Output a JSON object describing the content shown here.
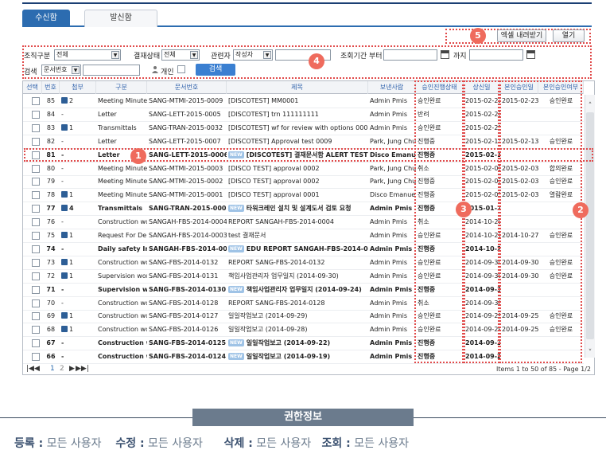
{
  "tabs": {
    "received": "수신함",
    "sent": "발신함"
  },
  "actions": {
    "excel": "엑셀 내려받기",
    "view": "열기"
  },
  "search": {
    "org_label": "조직구분",
    "org_value": "전체",
    "status_label": "결재상태",
    "status_value": "전체",
    "related_label": "관련자",
    "related_value": "작성자",
    "period_label": "조회기간 부터",
    "period_to_label": "까지",
    "search_label": "검색",
    "search_field": "문서번호",
    "personal_label": "개인",
    "search_button": "검색"
  },
  "columns": [
    "선택",
    "번호",
    "첨부",
    "구분",
    "문서번호",
    "제목",
    "보낸사람",
    "승인진행상태",
    "상신일",
    "본인승인일",
    "본인승인여부"
  ],
  "rows": [
    {
      "no": "85",
      "att": "2",
      "disk": true,
      "type": "Meeting Minutes",
      "doc": "SANG-MTMI-2015-0009",
      "title": "[DISCOTEST] MM0001",
      "new": false,
      "sender": "Admin Pmis",
      "status": "승인완료",
      "date": "2015-02-23",
      "my_date": "2015-02-23",
      "my_status": "승인완료",
      "bold": false
    },
    {
      "no": "84",
      "att": "-",
      "disk": false,
      "type": "Letter",
      "doc": "SANG-LETT-2015-0005",
      "title": "[DISCOTEST] trn 111111111",
      "new": false,
      "sender": "Admin Pmis",
      "status": "반려",
      "date": "2015-02-23",
      "my_date": "",
      "my_status": "",
      "bold": false
    },
    {
      "no": "83",
      "att": "1",
      "disk": true,
      "type": "Transmittals",
      "doc": "SANG-TRAN-2015-0032",
      "title": "[DISCOTEST] wf for review with options 0001",
      "new": false,
      "sender": "Admin Pmis",
      "status": "승인완료",
      "date": "2015-02-23",
      "my_date": "",
      "my_status": "",
      "bold": false
    },
    {
      "no": "82",
      "att": "-",
      "disk": false,
      "type": "Letter",
      "doc": "SANG-LETT-2015-0007",
      "title": "[DISCOTEST] Approval test 0009",
      "new": false,
      "sender": "Park, Jung Chul",
      "status": "진행중",
      "date": "2015-02-13",
      "my_date": "2015-02-13",
      "my_status": "승인완료",
      "bold": false
    },
    {
      "no": "81",
      "att": "-",
      "disk": false,
      "type": "Letter",
      "doc": "SANG-LETT-2015-0006",
      "title": "[DISCOTEST] 결재문서함 ALERT TEST 00",
      "new": true,
      "sender": "Disco Emanuel",
      "status": "진행중",
      "date": "2015-02-12",
      "my_date": "",
      "my_status": "",
      "bold": true
    },
    {
      "no": "80",
      "att": "-",
      "disk": false,
      "type": "Meeting Minutes",
      "doc": "SANG-MTMI-2015-0003",
      "title": "[DISCO TEST] approval 0002",
      "new": false,
      "sender": "Park, Jung Chul",
      "status": "취소",
      "date": "2015-02-03",
      "my_date": "2015-02-03",
      "my_status": "합의완료",
      "bold": false
    },
    {
      "no": "79",
      "att": "-",
      "disk": false,
      "type": "Meeting Minutes",
      "doc": "SANG-MTMI-2015-0002",
      "title": "[DISCO TEST] approval 0002",
      "new": false,
      "sender": "Park, Jung Chul",
      "status": "진행중",
      "date": "2015-02-03",
      "my_date": "2015-02-03",
      "my_status": "승인완료",
      "bold": false
    },
    {
      "no": "78",
      "att": "1",
      "disk": true,
      "type": "Meeting Minutes",
      "doc": "SANG-MTMI-2015-0001",
      "title": "[DISCO TEST] approval 0001",
      "new": false,
      "sender": "Disco Emanuel",
      "status": "진행중",
      "date": "2015-02-03",
      "my_date": "2015-02-03",
      "my_status": "열람완료",
      "bold": false
    },
    {
      "no": "77",
      "att": "4",
      "disk": true,
      "type": "Transmittals",
      "doc": "SANG-TRAN-2015-0001",
      "title": "타워크레인 설치 및 설계도서 검토 요청",
      "new": true,
      "sender": "Admin Pmis",
      "status": "진행중",
      "date": "2015-01-28",
      "my_date": "",
      "my_status": "",
      "bold": true
    },
    {
      "no": "76",
      "att": "-",
      "disk": false,
      "type": "Construction wo",
      "doc": "SANGAH-FBS-2014-0004",
      "title": "REPORT SANGAH-FBS-2014-0004",
      "new": false,
      "sender": "Admin Pmis",
      "status": "취소",
      "date": "2014-10-29",
      "my_date": "",
      "my_status": "",
      "bold": false
    },
    {
      "no": "75",
      "att": "1",
      "disk": true,
      "type": "Request For De",
      "doc": "SANGAH-FBS-2014-0003",
      "title": "test 결재문서",
      "new": false,
      "sender": "Admin Pmis",
      "status": "승인완료",
      "date": "2014-10-27",
      "my_date": "2014-10-27",
      "my_status": "승인완료",
      "bold": false
    },
    {
      "no": "74",
      "att": "-",
      "disk": false,
      "type": "Daily safety Ins",
      "doc": "SANGAH-FBS-2014-0002",
      "title": "EDU REPORT SANGAH-FBS-2014-0002",
      "new": true,
      "sender": "Admin Pmis",
      "status": "진행중",
      "date": "2014-10-22",
      "my_date": "",
      "my_status": "",
      "bold": true
    },
    {
      "no": "73",
      "att": "1",
      "disk": true,
      "type": "Construction wo",
      "doc": "SANG-FBS-2014-0132",
      "title": "REPORT SANG-FBS-2014-0132",
      "new": false,
      "sender": "Admin Pmis",
      "status": "승인완료",
      "date": "2014-09-30",
      "my_date": "2014-09-30",
      "my_status": "승인완료",
      "bold": false
    },
    {
      "no": "72",
      "att": "1",
      "disk": true,
      "type": "Supervision wor",
      "doc": "SANG-FBS-2014-0131",
      "title": "책임사업관리자 업무일지 (2014-09-30)",
      "new": false,
      "sender": "Admin Pmis",
      "status": "승인완료",
      "date": "2014-09-30",
      "my_date": "2014-09-30",
      "my_status": "승인완료",
      "bold": false
    },
    {
      "no": "71",
      "att": "-",
      "disk": false,
      "type": "Supervision wo",
      "doc": "SANG-FBS-2014-0130",
      "title": "책임사업관리자 업무일지 (2014-09-24)",
      "new": true,
      "sender": "Admin Pmis",
      "status": "진행중",
      "date": "2014-09-30",
      "my_date": "",
      "my_status": "",
      "bold": true
    },
    {
      "no": "70",
      "att": "-",
      "disk": false,
      "type": "Construction wo",
      "doc": "SANG-FBS-2014-0128",
      "title": "REPORT SANG-FBS-2014-0128",
      "new": false,
      "sender": "Admin Pmis",
      "status": "취소",
      "date": "2014-09-30",
      "my_date": "",
      "my_status": "",
      "bold": false
    },
    {
      "no": "69",
      "att": "1",
      "disk": true,
      "type": "Construction wo",
      "doc": "SANG-FBS-2014-0127",
      "title": "일일작업보고 (2014-09-29)",
      "new": false,
      "sender": "Admin Pmis",
      "status": "승인완료",
      "date": "2014-09-29",
      "my_date": "2014-09-25",
      "my_status": "승인완료",
      "bold": false
    },
    {
      "no": "68",
      "att": "1",
      "disk": true,
      "type": "Construction wo",
      "doc": "SANG-FBS-2014-0126",
      "title": "일일작업보고 (2014-09-28)",
      "new": false,
      "sender": "Admin Pmis",
      "status": "승인완료",
      "date": "2014-09-29",
      "my_date": "2014-09-25",
      "my_status": "승인완료",
      "bold": false
    },
    {
      "no": "67",
      "att": "-",
      "disk": false,
      "type": "Construction w",
      "doc": "SANG-FBS-2014-0125",
      "title": "일일작업보고 (2014-09-22)",
      "new": true,
      "sender": "Admin Pmis",
      "status": "진행중",
      "date": "2014-09-25",
      "my_date": "",
      "my_status": "",
      "bold": true
    },
    {
      "no": "66",
      "att": "-",
      "disk": false,
      "type": "Construction w",
      "doc": "SANG-FBS-2014-0124",
      "title": "일일작업보고 (2014-09-19)",
      "new": true,
      "sender": "Admin Pmis",
      "status": "진행중",
      "date": "2014-09-25",
      "my_date": "",
      "my_status": "",
      "bold": true
    }
  ],
  "new_label": "NEW",
  "pager": {
    "first": "|◀◀",
    "prev": "◀",
    "page1": "1",
    "page2": "2",
    "next": "▶",
    "last": "▶▶|",
    "info": "Items 1 to 50 of 85 - Page 1/2"
  },
  "markers": [
    "1",
    "2",
    "3",
    "4",
    "5"
  ],
  "footer": {
    "title": "권한정보",
    "reg_label": "등록 :",
    "reg_value": "모든 사용자",
    "edit_label": "수정 :",
    "edit_value": "모든 사용자",
    "del_label": "삭제 :",
    "del_value": "모든 사용자",
    "view_label": "조회 :",
    "view_value": "모든 사용자"
  },
  "colors": {
    "accent": "#2c6cb0",
    "annotation": "#e14b4b",
    "marker": "#ef6b5d",
    "footer_bar": "#6b7b8d"
  },
  "icons": {
    "attachment": "disk-icon",
    "calendar": "calendar-icon",
    "person": "person-icon"
  }
}
